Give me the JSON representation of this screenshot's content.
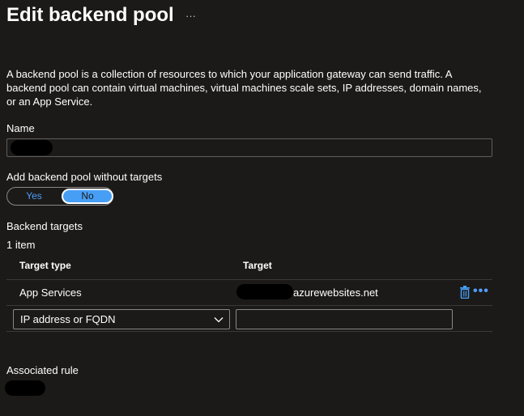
{
  "header": {
    "title": "Edit backend pool",
    "more_label": "···"
  },
  "description": "A backend pool is a collection of resources to which your application gateway can send traffic. A backend pool can contain virtual machines, virtual machines scale sets, IP addresses, domain names, or an App Service.",
  "name_field": {
    "label": "Name",
    "value": ""
  },
  "without_targets": {
    "label": "Add backend pool without targets",
    "options": [
      "Yes",
      "No"
    ],
    "selected": "No"
  },
  "backend_targets": {
    "label": "Backend targets",
    "count_text": "1 item",
    "columns": [
      "Target type",
      "Target"
    ],
    "rows": [
      {
        "type": "App Services",
        "target": "azurewebsites.net"
      }
    ],
    "new_row": {
      "type_selected": "IP address or FQDN",
      "target_value": ""
    }
  },
  "associated_rule": {
    "label": "Associated rule"
  },
  "icons": {
    "row_delete": "trash-icon",
    "row_more": "more-icon",
    "dropdown": "chevron-down-icon"
  },
  "colors": {
    "background": "#1b1a19",
    "accent": "#479ef5",
    "border": "#8a8886"
  }
}
